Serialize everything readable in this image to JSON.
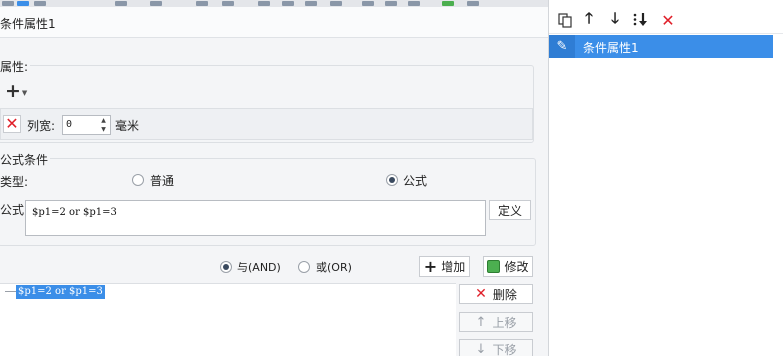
{
  "dialog": {
    "title": "条件属性1"
  },
  "attributes": {
    "group_title": "属性:",
    "add_icon": "plus-icon",
    "column_width_label": "列宽:",
    "column_width_value": "0",
    "unit_label": "毫米"
  },
  "formula_condition": {
    "group_title": "公式条件",
    "type_label": "类型:",
    "type_options": [
      "普通",
      "公式"
    ],
    "selected_type": "公式",
    "formula_label": "公式=",
    "formula_value": "$p1=2 or $p1=3",
    "define_button": "定义"
  },
  "logic": {
    "options": [
      "与(AND)",
      "或(OR)"
    ],
    "selected": "与(AND)",
    "add_button": "增加",
    "modify_button": "修改"
  },
  "condition_list": {
    "items": [
      "$p1=2 or $p1=3"
    ],
    "delete_button": "删除",
    "move_up_button": "上移",
    "move_down_button": "下移"
  },
  "right_panel": {
    "toolbar_icons": [
      "copy-icon",
      "arrow-up-icon",
      "arrow-down-icon",
      "sort-down-icon",
      "delete-icon"
    ],
    "items": [
      "条件属性1"
    ]
  },
  "colors": {
    "selection": "#3b8ee8",
    "delete_red": "#e0202a",
    "panel_bg": "#f4f5f7"
  }
}
